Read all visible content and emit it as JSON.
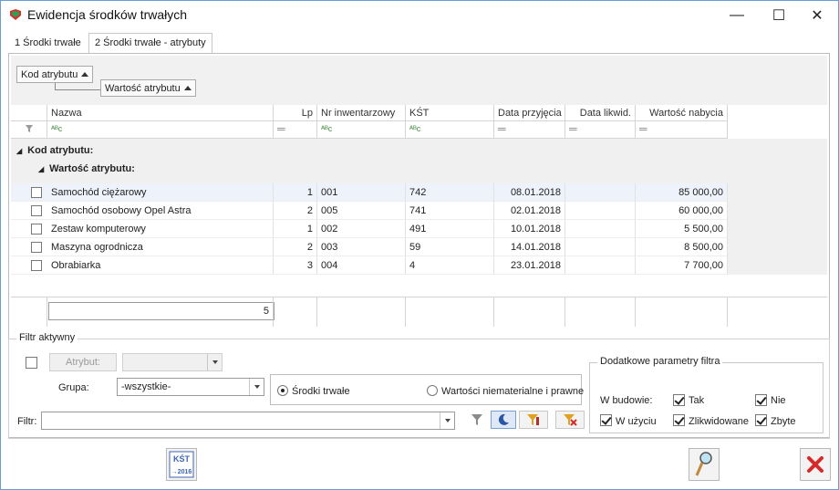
{
  "window": {
    "title": "Ewidencja środków trwałych",
    "minimize": "—",
    "maximize": "☐",
    "close": "✕"
  },
  "tabs": [
    {
      "label": "1 Środki trwałe"
    },
    {
      "label": "2 Środki trwałe - atrybuty"
    }
  ],
  "grouping": {
    "level1": "Kod atrybutu",
    "level2": "Wartość atrybutu"
  },
  "grid": {
    "columns": [
      "Nazwa",
      "Lp",
      "Nr inwentarzowy",
      "KŚT",
      "Data przyjęcia",
      "Data likwid.",
      "Wartość nabycia"
    ],
    "filter_text_symbol": "ᴬᴮc",
    "group1_label": "Kod atrybutu:",
    "group2_label": "Wartość atrybutu:",
    "rows": [
      {
        "nazwa": "Samochód ciężarowy",
        "lp": "1",
        "nr": "001",
        "kst": "742",
        "data_p": "08.01.2018",
        "data_l": "",
        "wartosc": "85 000,00"
      },
      {
        "nazwa": "Samochód osobowy Opel Astra",
        "lp": "2",
        "nr": "005",
        "kst": "741",
        "data_p": "02.01.2018",
        "data_l": "",
        "wartosc": "60 000,00"
      },
      {
        "nazwa": "Zestaw komputerowy",
        "lp": "1",
        "nr": "002",
        "kst": "491",
        "data_p": "10.01.2018",
        "data_l": "",
        "wartosc": "5 500,00"
      },
      {
        "nazwa": "Maszyna ogrodnicza",
        "lp": "2",
        "nr": "003",
        "kst": "59",
        "data_p": "14.01.2018",
        "data_l": "",
        "wartosc": "8 500,00"
      },
      {
        "nazwa": "Obrabiarka",
        "lp": "3",
        "nr": "004",
        "kst": "4",
        "data_p": "23.01.2018",
        "data_l": "",
        "wartosc": "7 700,00"
      }
    ],
    "count": "5"
  },
  "filter": {
    "legend": "Filtr aktywny",
    "atrybut_button": "Atrybut:",
    "grupa_label": "Grupa:",
    "grupa_value": "-wszystkie-",
    "radio1": "Środki trwałe",
    "radio2": "Wartości niematerialne i prawne",
    "filtr_label": "Filtr:",
    "filtr_value": ""
  },
  "extra": {
    "legend": "Dodatkowe parametry filtra",
    "w_budowie": "W budowie:",
    "tak": "Tak",
    "nie": "Nie",
    "w_uzyciu": "W użyciu",
    "zlikwidowane": "Zlikwidowane",
    "zbyte": "Zbyte"
  },
  "bottom": {
    "kst_icon_text": "KŚT",
    "kst_year": "→2016"
  },
  "colors": {
    "accent": "#3c64b4",
    "close_red": "#d62a2a",
    "selected_row": "#eef2fb"
  }
}
